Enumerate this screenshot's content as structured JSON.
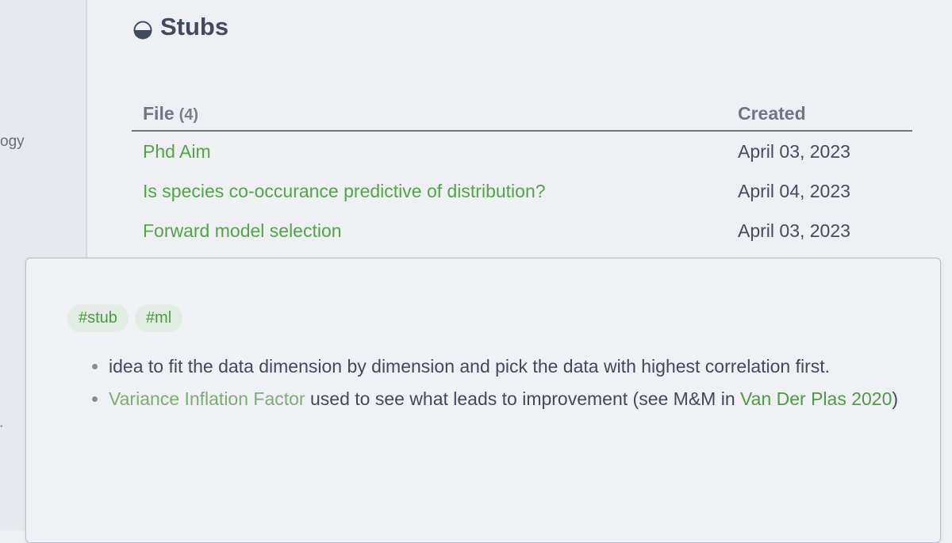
{
  "sidebar": {
    "fragment": "ogy",
    "dot": "•"
  },
  "page": {
    "title": "Stubs",
    "icon": "half-circle-icon"
  },
  "table": {
    "header_file": "File",
    "header_count": "(4)",
    "header_created": "Created",
    "rows": [
      {
        "file": "Phd Aim",
        "created": "April 03, 2023"
      },
      {
        "file": "Is species co-occurance predictive of distribution?",
        "created": "April 04, 2023"
      },
      {
        "file": "Forward model selection",
        "created": "April 03, 2023"
      }
    ]
  },
  "popover": {
    "tags": [
      "#stub",
      "#ml"
    ],
    "bullets": [
      {
        "text": "idea to fit the data dimension by dimension and pick the data with highest correlation first."
      },
      {
        "link1": "Variance Inflation Factor",
        "text_mid": " used to see what leads to improvement (see M&M in ",
        "link2": "Van Der Plas 2020",
        "text_end": ")"
      }
    ]
  },
  "colors": {
    "link": "#53a447",
    "faint_link": "#7aae72",
    "tag_bg": "#e1ece3",
    "text": "#444858"
  }
}
